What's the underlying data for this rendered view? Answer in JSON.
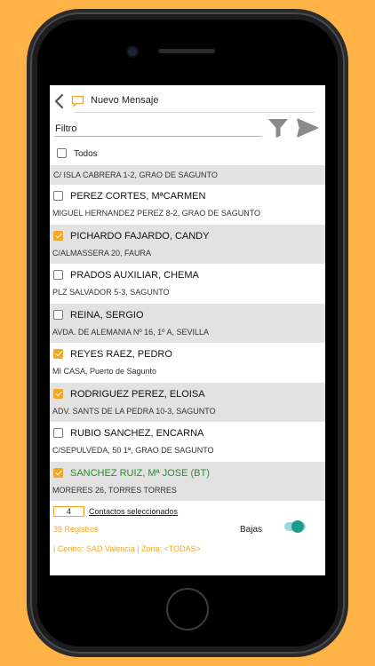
{
  "header": {
    "title": "Nuevo Mensaje"
  },
  "filter": {
    "value": "Filtro"
  },
  "todos": {
    "label": "Todos",
    "checked": false
  },
  "partial_address": "C/ ISLA CABRERA 1-2, GRAO DE SAGUNTO",
  "contacts": [
    {
      "name": "PEREZ CORTES, MªCARMEN",
      "address": "MIGUEL HERNANDEZ PEREZ 8-2, GRAO DE SAGUNTO",
      "checked": false,
      "shaded": false,
      "green": false
    },
    {
      "name": "PICHARDO FAJARDO, CANDY",
      "address": "C/ALMASSERA 20, FAURA",
      "checked": true,
      "shaded": true,
      "green": false
    },
    {
      "name": "PRADOS AUXILIAR, CHEMA",
      "address": "PLZ SALVADOR 5-3, SAGUNTO",
      "checked": false,
      "shaded": false,
      "green": false
    },
    {
      "name": "REINA, SERGIO",
      "address": "AVDA. DE ALEMANIA Nº 16, 1º A, SEVILLA",
      "checked": false,
      "shaded": true,
      "green": false
    },
    {
      "name": "REYES RAEZ, PEDRO",
      "address": "MI CASA, Puerto de Sagunto",
      "checked": true,
      "shaded": false,
      "green": false
    },
    {
      "name": "RODRIGUEZ PEREZ, ELOISA",
      "address": "ADV. SANTS DE LA PEDRA 10-3, SAGUNTO",
      "checked": true,
      "shaded": true,
      "green": false
    },
    {
      "name": "RUBIO SANCHEZ, ENCARNA",
      "address": "C/SEPULVEDA, 50 1ª, GRAO DE SAGUNTO",
      "checked": false,
      "shaded": false,
      "green": false
    },
    {
      "name": "SANCHEZ RUIZ, Mª JOSE (BT)",
      "address": "MORERES 26, TORRES TORRES",
      "checked": true,
      "shaded": true,
      "green": true
    }
  ],
  "footer": {
    "selected_count": "4",
    "selected_label": "Contactos seleccionados",
    "registros": "39 Registros",
    "bajas_label": "Bajas",
    "bajas_on": true,
    "centro_zona": "| Centro: SAD Valencia  | Zona: <TODAS>"
  },
  "colors": {
    "accent": "#F5A623",
    "background": "#FFB347",
    "shaded_row": "#e2e2e2",
    "bt_name": "#2f8a2f",
    "toggle": "#1a9c8f"
  },
  "icons": [
    "back-chevron-icon",
    "message-bubble-icon",
    "funnel-filter-icon",
    "send-icon"
  ]
}
